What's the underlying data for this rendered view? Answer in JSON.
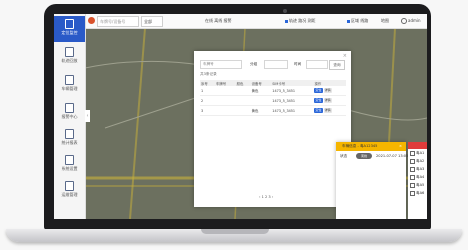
{
  "sidebar": {
    "items": [
      {
        "label": "定位监控",
        "icon": "location-icon"
      },
      {
        "label": "轨迹回放",
        "icon": "track-icon"
      },
      {
        "label": "车辆管理",
        "icon": "car-icon"
      },
      {
        "label": "报警中心",
        "icon": "alarm-icon"
      },
      {
        "label": "统计报表",
        "icon": "report-icon"
      },
      {
        "label": "系统设置",
        "icon": "settings-icon"
      },
      {
        "label": "运维管理",
        "icon": "ops-icon"
      }
    ],
    "collapse_glyph": "‹"
  },
  "toolbar": {
    "search_placeholder": "车牌号/设备号",
    "filter_label": "全部",
    "status_text": "在线 离线 报警",
    "options_a": "轨迹 路况 测距",
    "options_b": "区域 线路",
    "map_type": "地图",
    "user": "admin"
  },
  "modal": {
    "field_plate_label": "车牌号",
    "field_plate_value": "",
    "field_group_label": "分组",
    "field_date_label": "时间",
    "search_label": "查询",
    "subtitle": "共3条记录",
    "columns": [
      "序号",
      "车牌号",
      "颜色",
      "设备号",
      "SIM卡号",
      "操作"
    ],
    "rows": [
      {
        "no": "1",
        "plate": "",
        "color": "",
        "device": "黄色",
        "sim": "1473_5_3451",
        "actions": [
          "定位",
          "详情"
        ]
      },
      {
        "no": "2",
        "plate": "",
        "color": "",
        "device": "",
        "sim": "1473_5_3451",
        "actions": [
          "定位",
          "详情"
        ]
      },
      {
        "no": "3",
        "plate": "",
        "color": "",
        "device": "黄色",
        "sim": "1473_5_3451",
        "actions": [
          "定位",
          "详情"
        ]
      }
    ],
    "pager": "‹  1  2  3  ›",
    "close_glyph": "×"
  },
  "info_panel": {
    "title": "车辆信息 - 粤A12345",
    "close_glyph": "×",
    "status_label": "状态",
    "status_value": "离线",
    "time_text": "2021-07-07 13:05"
  },
  "vehicle_list": {
    "items": [
      "粤A1",
      "粤A2",
      "粤A3",
      "粤A4",
      "粤A5",
      "粤A6"
    ]
  }
}
